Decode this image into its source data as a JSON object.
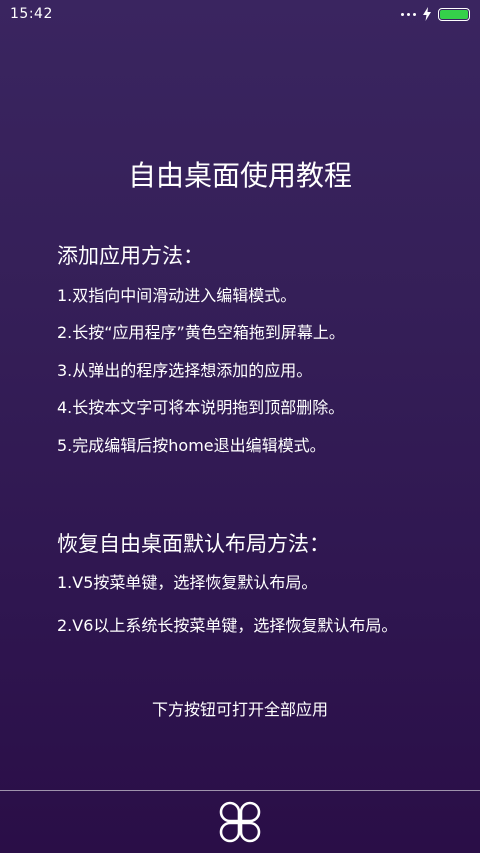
{
  "status_bar": {
    "time": "15:42",
    "icons": [
      "more-dots-icon",
      "charging-bolt-icon",
      "battery-icon"
    ],
    "battery_color": "#35d14a"
  },
  "tutorial": {
    "title": "自由桌面使用教程",
    "add_section": {
      "heading": "添加应用方法：",
      "steps": [
        "1.双指向中间滑动进入编辑模式。",
        "2.长按“应用程序”黄色空箱拖到屏幕上。",
        "3.从弹出的程序选择想添加的应用。",
        "4.长按本文字可将本说明拖到顶部删除。",
        "5.完成编辑后按home退出编辑模式。"
      ]
    },
    "restore_section": {
      "heading": "恢复自由桌面默认布局方法：",
      "steps": [
        "1.V5按菜单键，选择恢复默认布局。",
        "2.V6以上系统长按菜单键，选择恢复默认布局。"
      ]
    },
    "bottom_hint": "下方按钮可打开全部应用"
  },
  "dock": {
    "button_icon": "app-drawer-icon"
  },
  "colors": {
    "background_top": "#3a2560",
    "background_bottom": "#2a0e47",
    "text": "#ffffff"
  }
}
